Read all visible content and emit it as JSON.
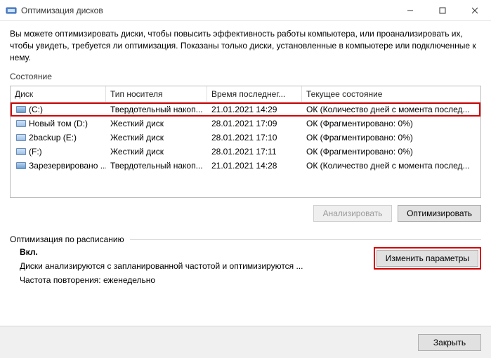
{
  "window": {
    "title": "Оптимизация дисков"
  },
  "intro": "Вы можете оптимизировать диски, чтобы повысить эффективность работы компьютера, или проанализировать их, чтобы увидеть, требуется ли оптимизация. Показаны только диски, установленные в компьютере или подключенные к нему.",
  "sections": {
    "state_label": "Состояние",
    "schedule_label": "Оптимизация по расписанию"
  },
  "columns": {
    "disk": "Диск",
    "media": "Тип носителя",
    "time": "Время последнег...",
    "state": "Текущее состояние"
  },
  "rows": [
    {
      "icon": "ssd",
      "disk": "(C:)",
      "media": "Твердотельный накоп...",
      "time": "21.01.2021 14:29",
      "state": "ОК (Количество дней с момента послед..."
    },
    {
      "icon": "hdd",
      "disk": "Новый том (D:)",
      "media": "Жесткий диск",
      "time": "28.01.2021 17:09",
      "state": "ОК (Фрагментировано: 0%)"
    },
    {
      "icon": "hdd",
      "disk": "2backup (E:)",
      "media": "Жесткий диск",
      "time": "28.01.2021 17:10",
      "state": "ОК (Фрагментировано: 0%)"
    },
    {
      "icon": "hdd",
      "disk": "(F:)",
      "media": "Жесткий диск",
      "time": "28.01.2021 17:11",
      "state": "ОК (Фрагментировано: 0%)"
    },
    {
      "icon": "ssd",
      "disk": "Зарезервировано ...",
      "media": "Твердотельный накоп...",
      "time": "21.01.2021 14:28",
      "state": "ОК (Количество дней с момента послед..."
    }
  ],
  "buttons": {
    "analyze": "Анализировать",
    "optimize": "Оптимизировать",
    "change": "Изменить параметры",
    "close": "Закрыть"
  },
  "schedule": {
    "enabled_label": "Вкл.",
    "line1": "Диски анализируются с запланированной частотой и оптимизируются ...",
    "line2": "Частота повторения: еженедельно"
  }
}
